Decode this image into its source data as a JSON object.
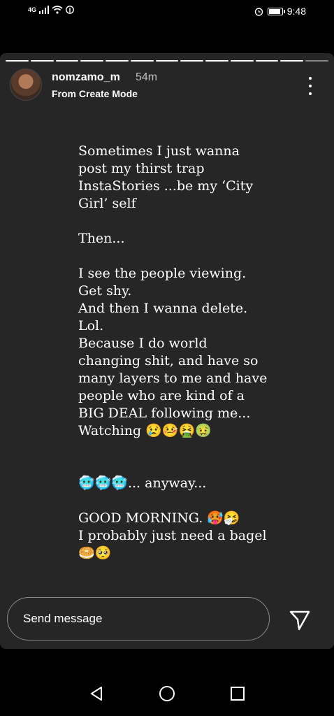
{
  "status_bar": {
    "signal_label": "4G",
    "time": "9:48"
  },
  "story": {
    "username": "nomzamo_m",
    "time_ago": "54m",
    "subtitle": "From Create Mode",
    "progress": {
      "segments": 13,
      "current": 12
    },
    "text_lines": [
      "Sometimes I just wanna",
      "post my thirst trap",
      "InstaStories ...be my ‘City",
      "Girl’ self",
      "",
      "Then...",
      "",
      "I see the people viewing.",
      "Get shy.",
      "And then I wanna delete.",
      "Lol.",
      "Because I do world",
      "changing shit, and have so",
      "many layers to me and have",
      "people who are kind of a",
      "BIG DEAL following me...",
      "Watching 😢🤒🤮🤢",
      "",
      "",
      "🥶🥶🥶... anyway...",
      "",
      "GOOD MORNING. 🥵🤧",
      "I probably just need a bagel",
      "🥯🥺"
    ]
  },
  "reply": {
    "placeholder": "Send message"
  },
  "icons": {
    "more": "more-vertical-icon",
    "send": "send-icon",
    "back": "back-triangle-icon",
    "home": "home-circle-icon",
    "recents": "recents-square-icon"
  }
}
